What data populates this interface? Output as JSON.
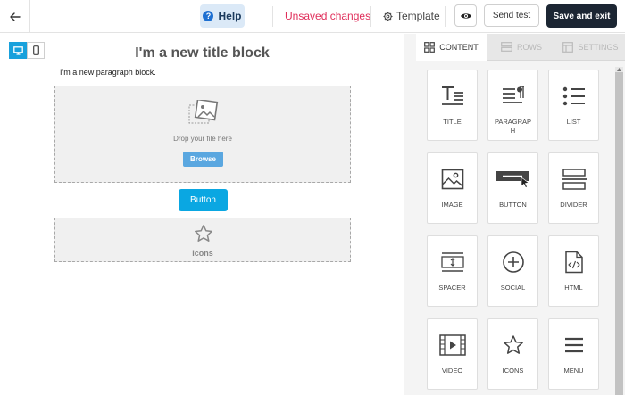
{
  "topbar": {
    "help_label": "Help",
    "help_badge": "?",
    "unsaved_label": "Unsaved changes",
    "template_label": "Template",
    "send_test_label": "Send test",
    "save_exit_label": "Save and exit"
  },
  "canvas": {
    "title_text": "I'm a new title block",
    "paragraph_text": "I'm a new paragraph block.",
    "image_block": {
      "drop_text": "Drop your file here",
      "browse_label": "Browse"
    },
    "button_label": "Button",
    "icons_label": "Icons"
  },
  "panel": {
    "tabs": [
      {
        "label": "CONTENT",
        "icon": "grid-icon",
        "active": true
      },
      {
        "label": "ROWS",
        "icon": "rows-icon",
        "active": false
      },
      {
        "label": "SETTINGS",
        "icon": "settings-icon",
        "active": false
      }
    ],
    "tiles": [
      {
        "label": "TITLE",
        "icon": "title-icon"
      },
      {
        "label": "PARAGRAPH",
        "icon": "paragraph-icon"
      },
      {
        "label": "LIST",
        "icon": "list-icon"
      },
      {
        "label": "IMAGE",
        "icon": "image-icon"
      },
      {
        "label": "BUTTON",
        "icon": "button-icon"
      },
      {
        "label": "DIVIDER",
        "icon": "divider-icon"
      },
      {
        "label": "SPACER",
        "icon": "spacer-icon"
      },
      {
        "label": "SOCIAL",
        "icon": "social-icon"
      },
      {
        "label": "HTML",
        "icon": "html-icon"
      },
      {
        "label": "VIDEO",
        "icon": "video-icon"
      },
      {
        "label": "ICONS",
        "icon": "star-icon"
      },
      {
        "label": "MENU",
        "icon": "menu-icon"
      }
    ]
  },
  "colors": {
    "accent": "#0aa7e2",
    "unsaved": "#e02f5b",
    "save_button": "#1c2633",
    "help_bg": "#dbe9f7"
  }
}
